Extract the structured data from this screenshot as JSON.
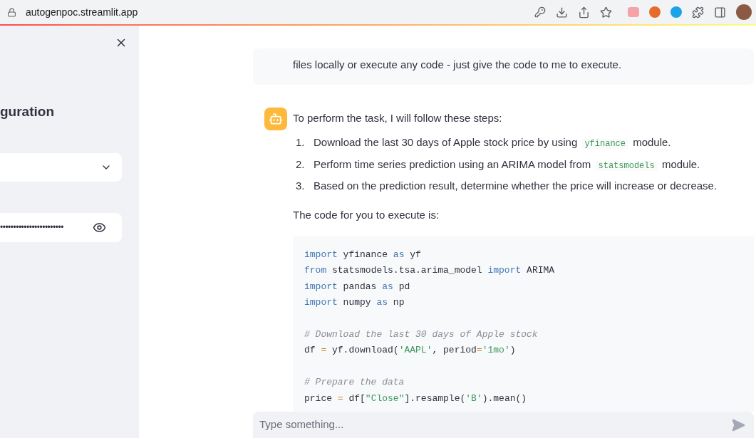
{
  "browser": {
    "url": "autogenpoc.streamlit.app"
  },
  "sidebar": {
    "heading": "guration",
    "password": {
      "value": "••••••••••••••••••••••••"
    }
  },
  "chat": {
    "messages": [
      {
        "kind": "user",
        "text": "files locally or execute any code - just give the code to me to execute."
      },
      {
        "kind": "assistant",
        "intro": "To perform the task, I will follow these steps:",
        "steps": [
          {
            "number": "1.",
            "parts": [
              {
                "kind": "text",
                "text": "Download the last 30 days of Apple stock price by using "
              },
              {
                "kind": "code",
                "text": "yfinance"
              },
              {
                "kind": "text",
                "text": " module."
              }
            ]
          },
          {
            "number": "2.",
            "parts": [
              {
                "kind": "text",
                "text": "Perform time series prediction using an ARIMA model from "
              },
              {
                "kind": "code",
                "text": "statsmodels"
              },
              {
                "kind": "text",
                "text": " module."
              }
            ]
          },
          {
            "number": "3.",
            "parts": [
              {
                "kind": "text",
                "text": "Based on the prediction result, determine whether the price will increase or decrease."
              }
            ]
          }
        ],
        "outro": "The code for you to execute is:",
        "code": [
          [
            {
              "kind": "keyword",
              "text": "import"
            },
            {
              "kind": "plain",
              "text": " yfinance "
            },
            {
              "kind": "keyword",
              "text": "as"
            },
            {
              "kind": "plain",
              "text": " yf"
            }
          ],
          [
            {
              "kind": "keyword",
              "text": "from"
            },
            {
              "kind": "plain",
              "text": " statsmodels.tsa.arima_model "
            },
            {
              "kind": "keyword",
              "text": "import"
            },
            {
              "kind": "plain",
              "text": " ARIMA"
            }
          ],
          [
            {
              "kind": "keyword",
              "text": "import"
            },
            {
              "kind": "plain",
              "text": " pandas "
            },
            {
              "kind": "keyword",
              "text": "as"
            },
            {
              "kind": "plain",
              "text": " pd"
            }
          ],
          [
            {
              "kind": "keyword",
              "text": "import"
            },
            {
              "kind": "plain",
              "text": " numpy "
            },
            {
              "kind": "keyword",
              "text": "as"
            },
            {
              "kind": "plain",
              "text": " np"
            }
          ],
          {
            "kind": "blank"
          },
          [
            {
              "kind": "comment",
              "text": "# Download the last 30 days of Apple stock"
            }
          ],
          [
            {
              "kind": "plain",
              "text": "df "
            },
            {
              "kind": "operator",
              "text": "="
            },
            {
              "kind": "plain",
              "text": " yf.download("
            },
            {
              "kind": "string",
              "text": "'AAPL'"
            },
            {
              "kind": "plain",
              "text": ", period"
            },
            {
              "kind": "operator",
              "text": "="
            },
            {
              "kind": "string",
              "text": "'1mo'"
            },
            {
              "kind": "plain",
              "text": ")"
            }
          ],
          {
            "kind": "blank"
          },
          [
            {
              "kind": "comment",
              "text": "# Prepare the data"
            }
          ],
          [
            {
              "kind": "plain",
              "text": "price "
            },
            {
              "kind": "operator",
              "text": "="
            },
            {
              "kind": "plain",
              "text": " df["
            },
            {
              "kind": "string",
              "text": "\"Close\""
            },
            {
              "kind": "plain",
              "text": "].resample("
            },
            {
              "kind": "string",
              "text": "'B'"
            },
            {
              "kind": "plain",
              "text": ").mean()"
            }
          ]
        ]
      }
    ],
    "input": {
      "placeholder": "Type something..."
    }
  }
}
